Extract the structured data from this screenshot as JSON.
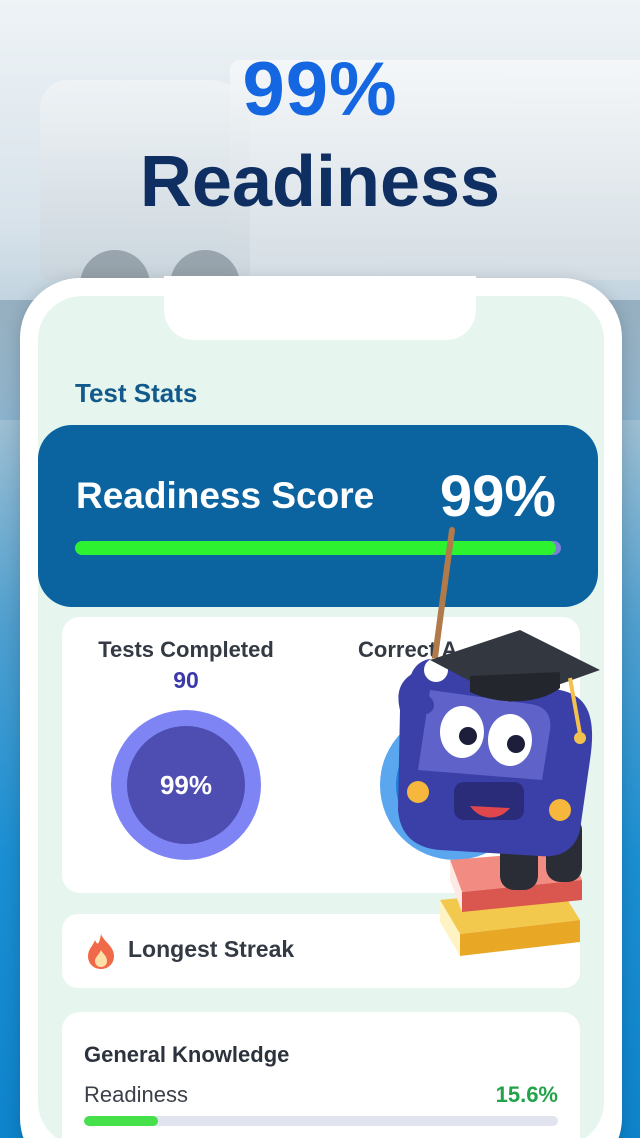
{
  "promo": {
    "headline_percent": "99%",
    "headline_word": "Readiness"
  },
  "screen": {
    "section_title": "Test Stats",
    "readiness_card": {
      "label": "Readiness Score",
      "value": "99%",
      "progress": 0.99
    },
    "stats": {
      "tests_completed": {
        "label": "Tests Completed",
        "value": "90",
        "ring_value": "99%"
      },
      "correct_answers": {
        "label": "Correct A",
        "ring_value": ""
      }
    },
    "streak": {
      "label": "Longest Streak",
      "icon": "flame-icon"
    },
    "general_knowledge": {
      "title": "General Knowledge",
      "sub_label": "Readiness",
      "percent": "15.6%",
      "progress": 0.156
    }
  },
  "colors": {
    "headline_blue": "#1467e0",
    "headline_navy": "#0f2f63",
    "card_blue": "#0b63a0",
    "progress_green": "#2cf22f",
    "percent_green": "#22a34a",
    "ring_purple": "#4d4db2"
  }
}
